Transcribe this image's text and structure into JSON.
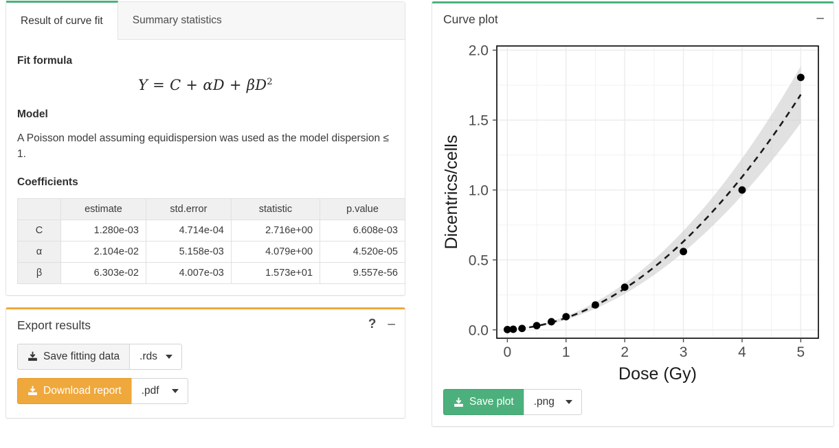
{
  "tabs": [
    {
      "label": "Result of curve fit",
      "active": true
    },
    {
      "label": "Summary statistics",
      "active": false
    }
  ],
  "fit_panel": {
    "fit_formula_heading": "Fit formula",
    "formula_parts": {
      "y": "Y",
      "eq": "=",
      "c": "C",
      "plus1": "+",
      "alpha": "α",
      "d1": "D",
      "plus2": "+",
      "beta": "β",
      "d2": "D",
      "exp": "2"
    },
    "formula_text": "Y = C + αD + βD²",
    "model_heading": "Model",
    "model_text": "A Poisson model assuming equidispersion was used as the model dispersion ≤ 1.",
    "coefficients_heading": "Coefficients",
    "coefficients_table": {
      "corner": "",
      "columns": [
        "estimate",
        "std.error",
        "statistic",
        "p.value"
      ],
      "rows": [
        {
          "name": "C",
          "cells": [
            "1.280e-03",
            "4.714e-04",
            "2.716e+00",
            "6.608e-03"
          ]
        },
        {
          "name": "α",
          "cells": [
            "2.104e-02",
            "5.158e-03",
            "4.079e+00",
            "4.520e-05"
          ]
        },
        {
          "name": "β",
          "cells": [
            "6.303e-02",
            "4.007e-03",
            "1.573e+01",
            "9.557e-56"
          ]
        }
      ]
    }
  },
  "export_panel": {
    "title": "Export results",
    "help_icon": "question-mark-icon",
    "minimize_icon": "minus-icon",
    "save_fitting_data_label": "Save fitting data",
    "save_fitting_data_format": ".rds",
    "download_report_label": "Download report",
    "download_report_format": ".pdf"
  },
  "plot_panel": {
    "title": "Curve plot",
    "minimize_icon": "minus-icon",
    "save_plot_label": "Save plot",
    "save_plot_format": ".png"
  },
  "colors": {
    "accent_green": "#4cb07c",
    "accent_orange": "#efa83c",
    "panel_border": "#e3e3e3",
    "table_header_bg": "#f0f0f0",
    "band_grey": "#c8c8c8"
  },
  "chart_data": {
    "type": "scatter",
    "title": "",
    "xlabel": "Dose (Gy)",
    "ylabel": "Dicentrics/cells",
    "xlim": [
      -0.18,
      5.3
    ],
    "ylim": [
      -0.06,
      2.03
    ],
    "xticks": [
      "0",
      "1",
      "2",
      "3",
      "4",
      "5"
    ],
    "xtick_values": [
      0,
      1,
      2,
      3,
      4,
      5
    ],
    "yticks": [
      "0.0",
      "0.5",
      "1.0",
      "1.5",
      "2.0"
    ],
    "ytick_values": [
      0.0,
      0.5,
      1.0,
      1.5,
      2.0
    ],
    "grid": true,
    "legend": "none",
    "points": [
      {
        "x": 0.0,
        "y": 0.002
      },
      {
        "x": 0.1,
        "y": 0.004
      },
      {
        "x": 0.25,
        "y": 0.01
      },
      {
        "x": 0.5,
        "y": 0.03
      },
      {
        "x": 0.75,
        "y": 0.058
      },
      {
        "x": 1.0,
        "y": 0.094
      },
      {
        "x": 1.5,
        "y": 0.178
      },
      {
        "x": 2.0,
        "y": 0.305
      },
      {
        "x": 3.0,
        "y": 0.56
      },
      {
        "x": 4.0,
        "y": 1.0
      },
      {
        "x": 5.0,
        "y": 1.805
      }
    ],
    "fit_curve": {
      "style": "dashed",
      "color": "#1a1a1a",
      "formula": "Y = C + aD + bD^2",
      "C": 0.00128,
      "alpha": 0.02104,
      "beta": 0.06303
    },
    "confidence_band": {
      "fill": "#c8c8c8",
      "opacity": 0.55,
      "se_C": 0.0004714,
      "se_alpha": 0.005158,
      "se_beta": 0.004007
    }
  }
}
